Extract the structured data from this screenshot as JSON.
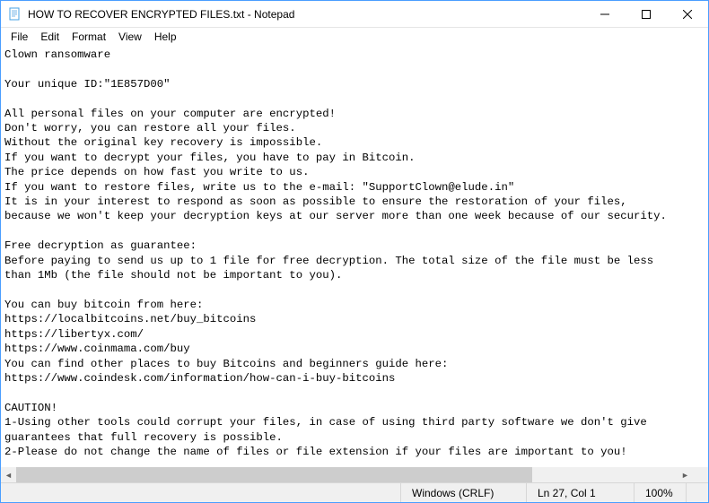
{
  "window": {
    "title": "HOW TO RECOVER ENCRYPTED FILES.txt - Notepad"
  },
  "menu": {
    "file": "File",
    "edit": "Edit",
    "format": "Format",
    "view": "View",
    "help": "Help"
  },
  "editor": {
    "content": "Clown ransomware\n\nYour unique ID:\"1E857D00\"\n\nAll personal files on your computer are encrypted!\nDon't worry, you can restore all your files.\nWithout the original key recovery is impossible.\nIf you want to decrypt your files, you have to pay in Bitcoin.\nThe price depends on how fast you write to us.\nIf you want to restore files, write us to the e-mail: \"SupportClown@elude.in\"\nIt is in your interest to respond as soon as possible to ensure the restoration of your files,\nbecause we won't keep your decryption keys at our server more than one week because of our security.\n\nFree decryption as guarantee:\nBefore paying to send us up to 1 file for free decryption. The total size of the file must be less\nthan 1Mb (the file should not be important to you).\n\nYou can buy bitcoin from here:\nhttps://localbitcoins.net/buy_bitcoins\nhttps://libertyx.com/\nhttps://www.coinmama.com/buy\nYou can find other places to buy Bitcoins and beginners guide here:\nhttps://www.coindesk.com/information/how-can-i-buy-bitcoins\n\nCAUTION!\n1-Using other tools could corrupt your files, in case of using third party software we don't give\nguarantees that full recovery is possible.\n2-Please do not change the name of files or file extension if your files are important to you!"
  },
  "status": {
    "encoding": "Windows (CRLF)",
    "position": "Ln 27, Col 1",
    "zoom": "100%"
  }
}
